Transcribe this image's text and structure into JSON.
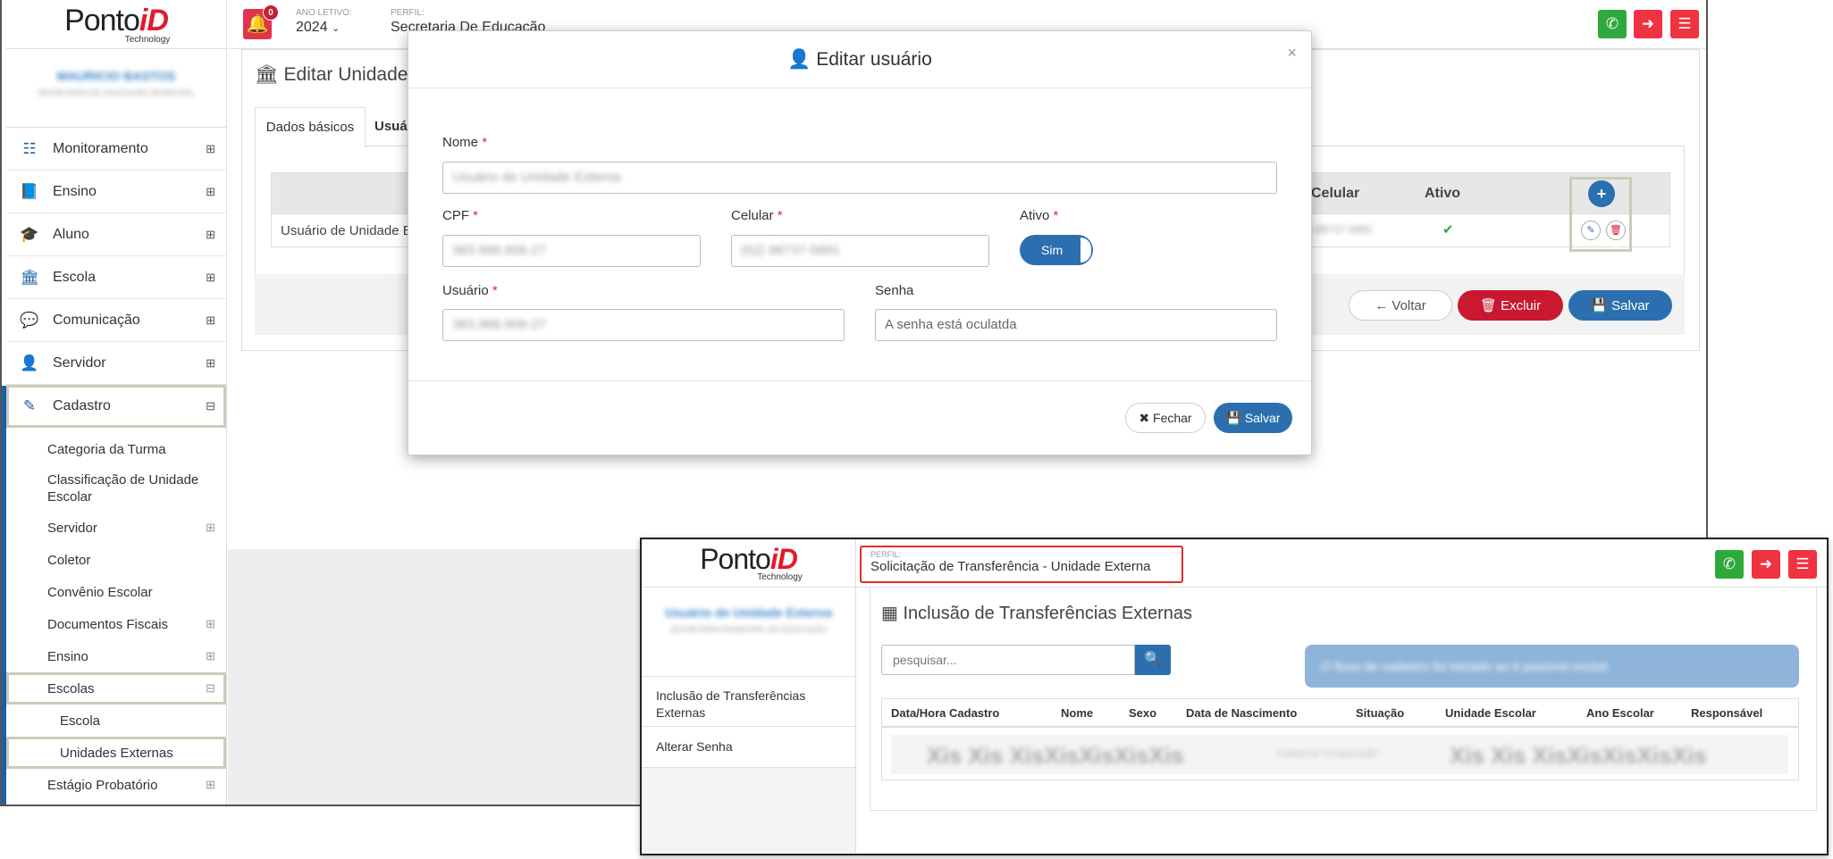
{
  "win1": {
    "logo": {
      "brand": "Ponto",
      "brand_accent": "iD",
      "tagline": "Technology"
    },
    "user": {
      "name": "MAURICIO BASTOS",
      "subtitle": "SECRETARIA DE EDUCAÇÃO MUNICIPAL"
    },
    "menu": [
      {
        "label": "Monitoramento",
        "icon": "sliders-icon",
        "toggle": "⊞"
      },
      {
        "label": "Ensino",
        "icon": "book-icon",
        "toggle": "⊞"
      },
      {
        "label": "Aluno",
        "icon": "graduation-cap-icon",
        "toggle": "⊞"
      },
      {
        "label": "Escola",
        "icon": "bank-icon",
        "toggle": "⊞"
      },
      {
        "label": "Comunicação",
        "icon": "chat-icon",
        "toggle": "⊞"
      },
      {
        "label": "Servidor",
        "icon": "user-icon",
        "toggle": "⊞"
      },
      {
        "label": "Cadastro",
        "icon": "edit-icon",
        "toggle": "⊟"
      }
    ],
    "submenu": [
      {
        "label": "Categoria da Turma",
        "toggle": ""
      },
      {
        "label": "Classificação de Unidade Escolar",
        "toggle": ""
      },
      {
        "label": "Servidor",
        "toggle": "⊞"
      },
      {
        "label": "Coletor",
        "toggle": ""
      },
      {
        "label": "Convênio Escolar",
        "toggle": ""
      },
      {
        "label": "Documentos Fiscais",
        "toggle": "⊞"
      },
      {
        "label": "Ensino",
        "toggle": "⊞"
      },
      {
        "label": "Escolas",
        "toggle": "⊟"
      },
      {
        "label": "Escola",
        "toggle": ""
      },
      {
        "label": "Unidades Externas",
        "toggle": ""
      },
      {
        "label": "Estágio Probatório",
        "toggle": "⊞"
      }
    ],
    "topbar": {
      "notif_count": "0",
      "ano_label": "ANO LETIVO:",
      "ano_value": "2024",
      "perfil_label": "PERFIL:",
      "perfil_value": "Secretaria De Educação"
    },
    "page_title": "Editar Unidade",
    "tabs": [
      "Dados básicos",
      "Usuá"
    ],
    "table": {
      "headers": [
        "Celular",
        "Ativo"
      ],
      "row_name": "Usuário de Unidade E",
      "row_phone": "(62) 98737-5891",
      "row_active": "✔"
    },
    "actions": {
      "back": "Voltar",
      "delete": "Excluir",
      "save": "Salvar"
    }
  },
  "modal": {
    "title": "Editar usuário",
    "close": "×",
    "nome_label": "Nome",
    "nome_value": "Usuário de Unidade Externa",
    "cpf_label": "CPF",
    "cpf_value": "383.988.906-27",
    "celular_label": "Celular",
    "celular_value": "(62) 98737-5891",
    "ativo_label": "Ativo",
    "ativo_value": "Sim",
    "usuario_label": "Usuário",
    "usuario_value": "383.988.906-27",
    "senha_label": "Senha",
    "senha_placeholder": "A senha está oculatda",
    "btn_close": "Fechar",
    "btn_save": "Salvar",
    "required": "*"
  },
  "win2": {
    "logo": {
      "brand": "Ponto",
      "brand_accent": "iD",
      "tagline": "Technology"
    },
    "perfil_label": "PERFIL:",
    "perfil_value": "Solicitação de Transferência - Unidade Externa",
    "user": {
      "name": "Usuário de Unidade Externa",
      "subtitle": "SECRETARIA MUNICIPAL DE EDUCAÇÃO"
    },
    "menu": [
      "Inclusão de Transferências Externas",
      "Alterar Senha"
    ],
    "page_title": "Inclusão de Transferências Externas",
    "search_placeholder": "pesquisar...",
    "info_banner": "O fluxo de cadastro foi iniciado ao é possível excluir",
    "headers": [
      "Data/Hora Cadastro",
      "Nome",
      "Sexo",
      "Data de Nascimento",
      "Situação",
      "Unidade Escolar",
      "Ano Escolar",
      "Responsável"
    ],
    "row_blur_left": "Xis Xis XisXisXisXisXis",
    "row_blur_mid": "Cadastrar recuperação",
    "row_blur_right": "Xis Xis XisXisXisXisXis"
  },
  "colors": {
    "primary": "#2c6fb0",
    "danger": "#c9182f",
    "green": "#2eaa3c",
    "red_btn": "#ef3340"
  }
}
